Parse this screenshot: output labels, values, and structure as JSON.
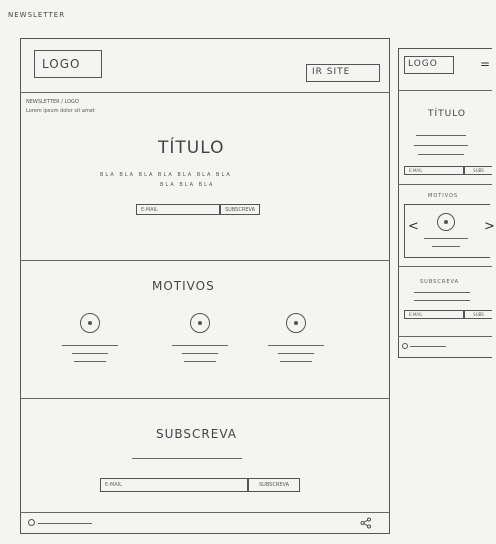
{
  "page_label": "NEWSLETTER",
  "desktop": {
    "logo": "LOGO",
    "cta": "IR SITE",
    "breadcrumb": [
      "NEWSLETTER / LOGO",
      "Lorem ipsum dolor sit amet"
    ],
    "hero_title": "TÍTULO",
    "hero_text": [
      "BLA BLA BLA BLA BLA BLA BLA",
      "BLA BLA BLA"
    ],
    "email_placeholder": "E-MAIL",
    "subscribe_btn": "SUBSCREVA",
    "motives_title": "MOTIVOS",
    "subscribe_title": "SUBSCREVA",
    "email_placeholder_2": "E-MAIL",
    "subscribe_btn_2": "SUBSCREVA"
  },
  "mobile": {
    "logo": "LOGO",
    "menu_icon": "=",
    "hero_title": "TÍTULO",
    "email_placeholder": "E-MAIL",
    "subscribe_btn": "SUBS",
    "motives_title": "MOTIVOS",
    "left_arrow": "<",
    "right_arrow": ">",
    "subscribe_title": "SUBSCREVA",
    "email_placeholder_2": "E-MAIL",
    "subscribe_btn_2": "SUBS"
  }
}
